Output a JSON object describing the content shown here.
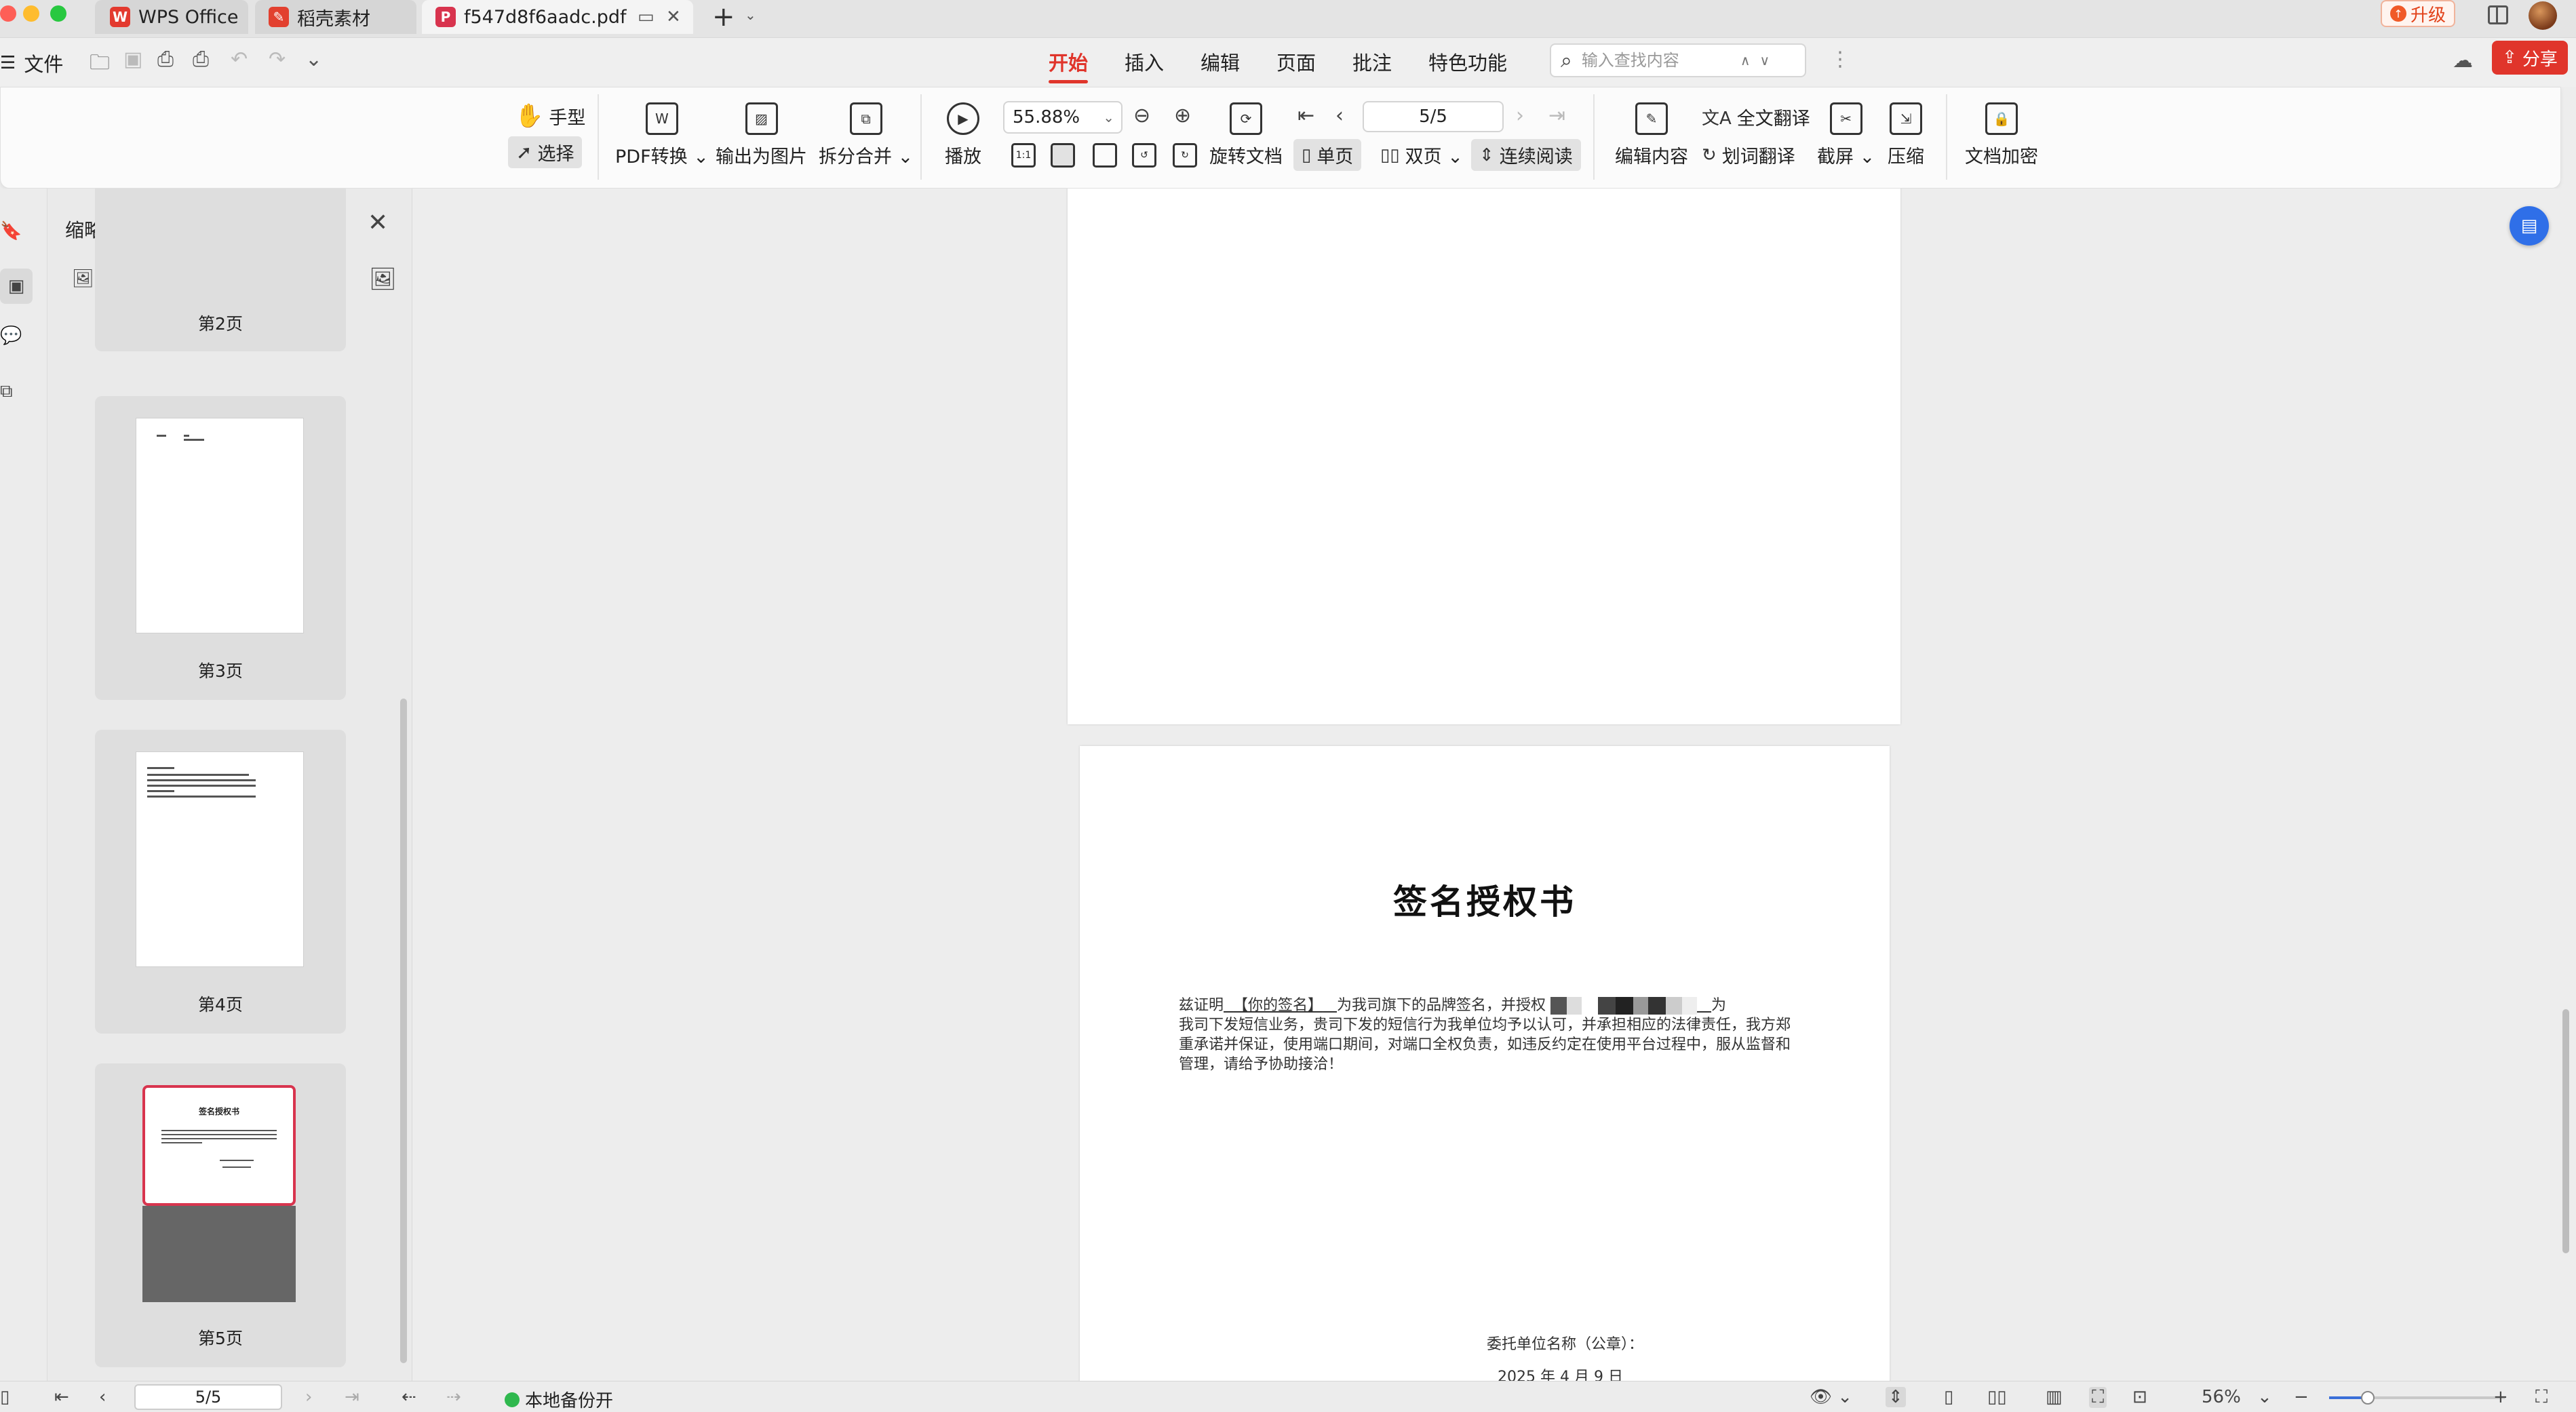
{
  "tabs": [
    {
      "label": "WPS Office",
      "icon": "wps-logo-icon"
    },
    {
      "label": "稻壳素材",
      "icon": "docer-icon"
    },
    {
      "label": "f547d8f6aadc.pdf",
      "icon": "pdf-icon",
      "active": true
    }
  ],
  "titlebar": {
    "upgrade_label": "升级"
  },
  "menubar": {
    "file_label": "文件",
    "tabs": [
      "开始",
      "插入",
      "编辑",
      "页面",
      "批注",
      "特色功能"
    ],
    "active_tab": "开始",
    "search_placeholder": "输入查找内容",
    "share_label": "分享"
  },
  "ribbon": {
    "hand_label": "手型",
    "select_label": "选择",
    "pdf_convert_label": "PDF转换",
    "export_image_label": "输出为图片",
    "split_merge_label": "拆分合并",
    "play_label": "播放",
    "zoom_value": "55.88%",
    "page_value": "5/5",
    "rotate_label": "旋转文档",
    "single_label": "单页",
    "double_label": "双页",
    "continuous_label": "连续阅读",
    "edit_content_label": "编辑内容",
    "full_translate_label": "全文翻译",
    "word_translate_label": "划词翻译",
    "screenshot_label": "截屏",
    "compress_label": "压缩",
    "encrypt_label": "文档加密",
    "actual_size_label": "1:1"
  },
  "thumbnails": {
    "title": "缩略图",
    "zoom_level": 0.12,
    "pages": [
      {
        "label": "第2页"
      },
      {
        "label": "第3页"
      },
      {
        "label": "第4页"
      },
      {
        "label": "第5页",
        "current": true
      }
    ],
    "page5_mini_title": "签名授权书"
  },
  "document": {
    "title": "签名授权书",
    "body_line1_prefix": "兹证明",
    "body_signature": "【你的签名】",
    "body_line1_mid": "为我司旗下的品牌签名，并授权",
    "body_line1_end": "为",
    "body_line2": "我司下发短信业务，贵司下发的短信行为我单位均予以认可，并承担相应的法律责任，我方郑",
    "body_line3": "重承诺并保证，使用端口期间，对端口全权负责，如违反约定在使用平台过程中，服从监督和",
    "body_line4": "管理，请给予协助接洽！",
    "entrusting_unit": "委托单位名称（公章）：",
    "date": "2025 年 4 月 9 日"
  },
  "statusbar": {
    "page_value": "5/5",
    "backup_label": "本地备份开",
    "zoom_percent": "56%",
    "zoom_level": 0.22
  }
}
